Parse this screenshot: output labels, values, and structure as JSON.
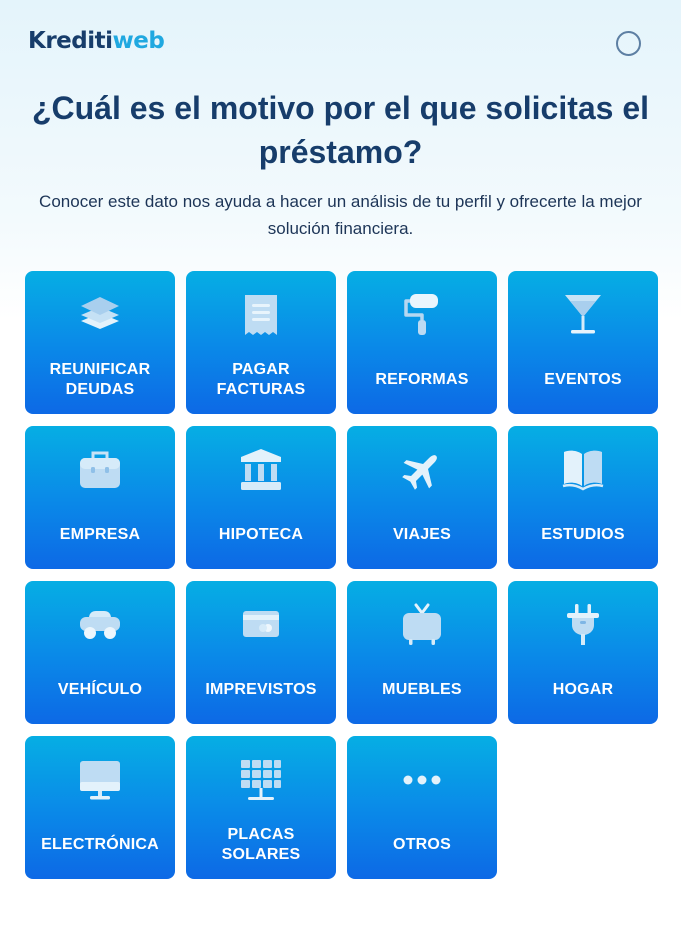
{
  "brand": {
    "name_part1": "Krediti",
    "name_part2": "web",
    "accent": "#20a8e0",
    "dark": "#173d6b"
  },
  "heading": "¿Cuál es el motivo por el que solicitas el préstamo?",
  "subtitle": "Conocer este dato nos ayuda a hacer un análisis de tu perfil y ofrecerte la mejor solución financiera.",
  "tiles": [
    {
      "label": "REUNIFICAR\nDEUDAS",
      "icon": "layers-icon"
    },
    {
      "label": "PAGAR\nFACTURAS",
      "icon": "receipt-icon"
    },
    {
      "label": "REFORMAS",
      "icon": "paint-roller-icon"
    },
    {
      "label": "EVENTOS",
      "icon": "cocktail-glass-icon"
    },
    {
      "label": "EMPRESA",
      "icon": "briefcase-icon"
    },
    {
      "label": "HIPOTECA",
      "icon": "bank-icon"
    },
    {
      "label": "VIAJES",
      "icon": "airplane-icon"
    },
    {
      "label": "ESTUDIOS",
      "icon": "open-book-icon"
    },
    {
      "label": "VEHÍCULO",
      "icon": "car-icon"
    },
    {
      "label": "IMPREVISTOS",
      "icon": "credit-card-icon"
    },
    {
      "label": "MUEBLES",
      "icon": "tv-icon"
    },
    {
      "label": "HOGAR",
      "icon": "plug-icon"
    },
    {
      "label": "ELECTRÓNICA",
      "icon": "monitor-icon"
    },
    {
      "label": "PLACAS\nSOLARES",
      "icon": "solar-panel-icon"
    },
    {
      "label": "OTROS",
      "icon": "more-dots-icon"
    }
  ],
  "colors": {
    "tile_top": "#06aee4",
    "tile_bottom": "#0d69e6"
  }
}
